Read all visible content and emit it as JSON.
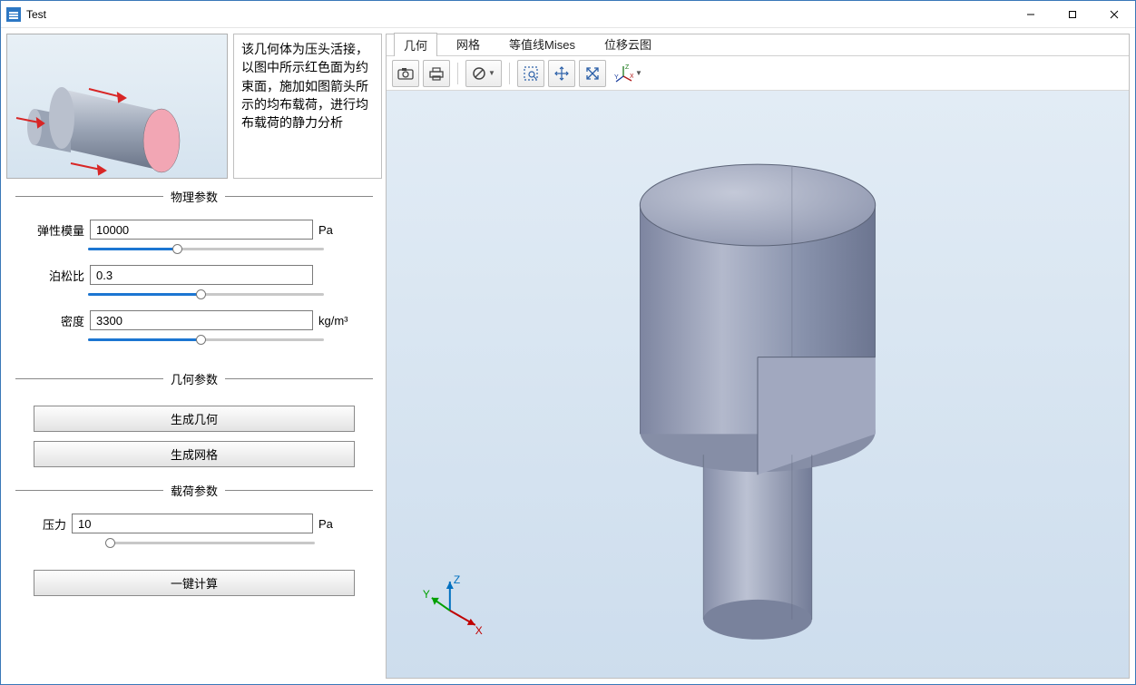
{
  "window": {
    "title": "Test"
  },
  "description": "该几何体为压头活接，以图中所示红色面为约束面，施加如图箭头所示的均布载荷，进行均布载荷的静力分析",
  "groups": {
    "physics": {
      "title": "物理参数",
      "elastic_modulus": {
        "label": "弹性模量",
        "value": "10000",
        "unit": "Pa",
        "slider_pct": 38
      },
      "poisson": {
        "label": "泊松比",
        "value": "0.3",
        "slider_pct": 48
      },
      "density": {
        "label": "密度",
        "value": "3300",
        "unit": "kg/m³",
        "slider_pct": 48
      }
    },
    "geometry": {
      "title": "几何参数",
      "gen_geometry_btn": "生成几何",
      "gen_mesh_btn": "生成网格"
    },
    "load": {
      "title": "载荷参数",
      "pressure": {
        "label": "压力",
        "value": "10",
        "unit": "Pa",
        "slider_pct": 2
      }
    },
    "compute_btn": "一键计算"
  },
  "tabs": [
    "几何",
    "网格",
    "等值线Mises",
    "位移云图"
  ],
  "active_tab_index": 0,
  "triad_labels": {
    "x": "X",
    "y": "Y",
    "z": "Z"
  }
}
